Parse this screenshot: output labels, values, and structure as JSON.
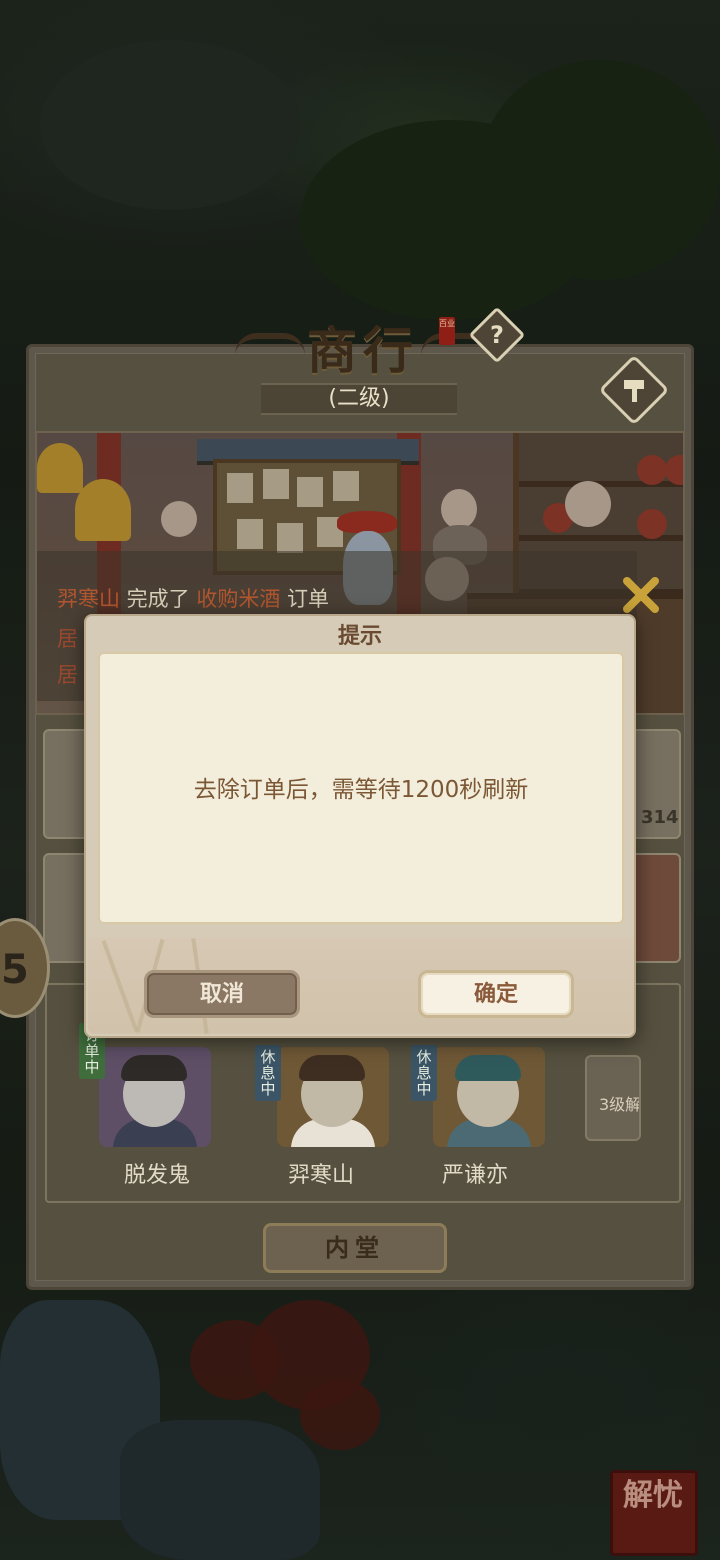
{
  "shop": {
    "title": "商行",
    "level": "(二级)",
    "seal_text": "百业",
    "help_label": "?"
  },
  "feed": {
    "line1_name": "羿寒山",
    "line1_mid": " 完成了 ",
    "line1_item": "收购米酒",
    "line1_end": " 订单",
    "line2_prefix": "居",
    "line3_prefix": "居"
  },
  "slot_count_text": "314",
  "staff": [
    {
      "name": "脱发鬼",
      "status": "订单中"
    },
    {
      "name": "羿寒山",
      "status": "休息中"
    },
    {
      "name": "严谦亦",
      "status": "休息中"
    }
  ],
  "locked_slot_text": "3级解",
  "inner_hall_button": "内堂",
  "side_button_glyph": "5",
  "seal_button_text": "解忧",
  "dialog": {
    "title": "提示",
    "message": "去除订单后，需等待1200秒刷新",
    "cancel_label": "取消",
    "ok_label": "确定"
  },
  "colors": {
    "dialog_text": "#7b5736",
    "highlight_text": "#b3562f",
    "status_green": "#3f6e3c",
    "status_blue": "#3b5566"
  }
}
